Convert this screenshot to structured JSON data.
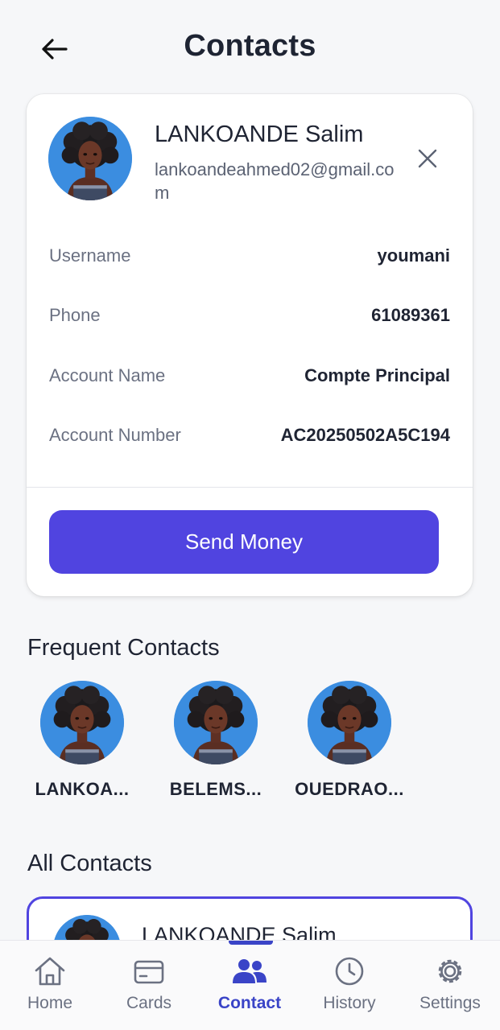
{
  "header": {
    "title": "Contacts"
  },
  "selected_contact": {
    "name": "LANKOANDE Salim",
    "email": "lankoandeahmed02@gmail.com",
    "fields": [
      {
        "label": "Username",
        "value": "youmani"
      },
      {
        "label": "Phone",
        "value": "61089361"
      },
      {
        "label": "Account Name",
        "value": "Compte Principal"
      },
      {
        "label": "Account Number",
        "value": "AC20250502A5C194"
      }
    ],
    "send_label": "Send Money"
  },
  "frequent": {
    "title": "Frequent Contacts",
    "items": [
      {
        "name": "LANKOA..."
      },
      {
        "name": "BELEMS..."
      },
      {
        "name": "OUEDRAO..."
      }
    ]
  },
  "all_contacts": {
    "title": "All Contacts",
    "items": [
      {
        "name": "LANKOANDE Salim"
      }
    ]
  },
  "tabbar": {
    "items": [
      {
        "label": "Home",
        "icon": "home-icon"
      },
      {
        "label": "Cards",
        "icon": "card-icon"
      },
      {
        "label": "Contact",
        "icon": "users-icon",
        "active": true
      },
      {
        "label": "History",
        "icon": "clock-icon"
      },
      {
        "label": "Settings",
        "icon": "gear-icon"
      }
    ]
  },
  "colors": {
    "primary": "#5044e0",
    "tab_active": "#3a44c7",
    "avatar_bg": "#3b8de0",
    "background": "#f6f7f9"
  }
}
